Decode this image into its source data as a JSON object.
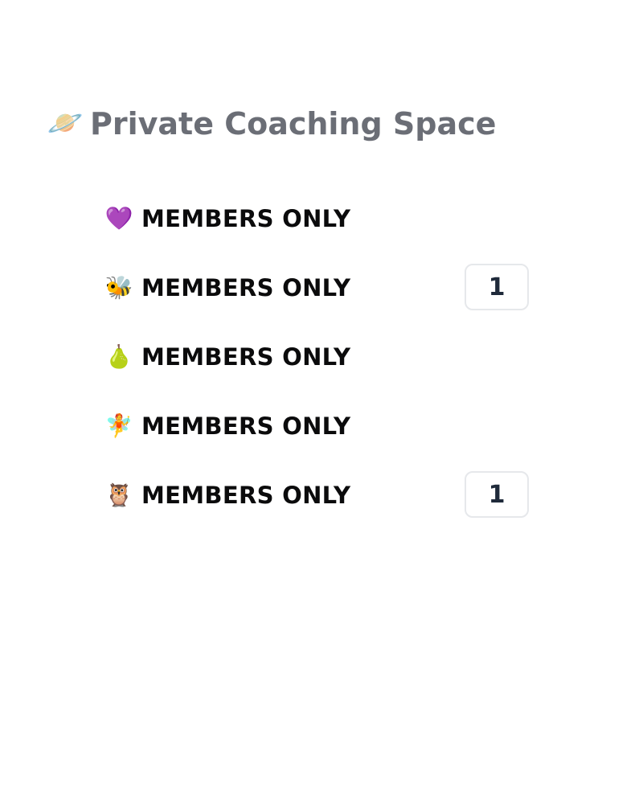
{
  "section": {
    "icon": "ringed-planet-icon",
    "emoji": "🪐",
    "title": "Private Coaching Space"
  },
  "channels": [
    {
      "icon": "purple-heart-icon",
      "emoji": "💜",
      "label": "MEMBERS ONLY",
      "count": ""
    },
    {
      "icon": "bee-icon",
      "emoji": "🐝",
      "label": "MEMBERS ONLY",
      "count": "1"
    },
    {
      "icon": "pear-icon",
      "emoji": "🍐",
      "label": "MEMBERS ONLY",
      "count": ""
    },
    {
      "icon": "fairy-icon",
      "emoji": "🧚",
      "label": "MEMBERS ONLY",
      "count": ""
    },
    {
      "icon": "owl-icon",
      "emoji": "🦉",
      "label": "MEMBERS ONLY",
      "count": "1"
    }
  ],
  "colors": {
    "title": "#6b6e76",
    "label": "#0b0b0c",
    "badge_text": "#1f2a3a",
    "badge_border": "#e6e8eb"
  }
}
